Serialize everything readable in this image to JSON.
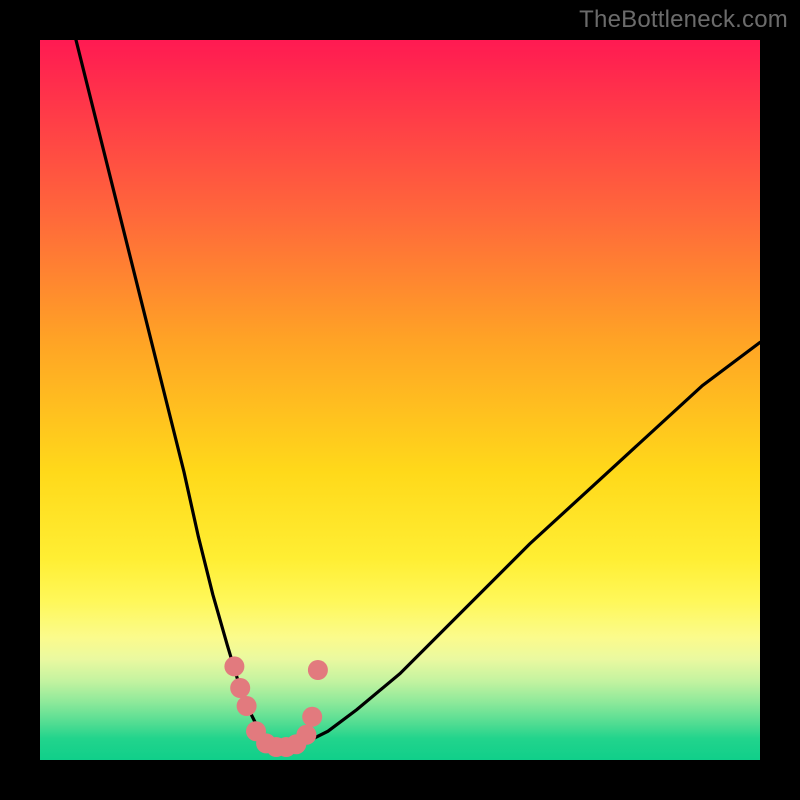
{
  "watermark": "TheBottleneck.com",
  "chart_data": {
    "type": "line",
    "title": "",
    "xlabel": "",
    "ylabel": "",
    "xlim": [
      0,
      100
    ],
    "ylim": [
      0,
      100
    ],
    "grid": false,
    "legend": false,
    "series": [
      {
        "name": "bottleneck-curve",
        "x": [
          5,
          8,
          11,
          14,
          17,
          20,
          22,
          24,
          26,
          27.5,
          29,
          30.5,
          32,
          33.5,
          35,
          37,
          40,
          44,
          50,
          58,
          68,
          80,
          92,
          100
        ],
        "y": [
          100,
          88,
          76,
          64,
          52,
          40,
          31,
          23,
          16,
          11,
          7,
          4,
          2.5,
          2,
          2,
          2.5,
          4,
          7,
          12,
          20,
          30,
          41,
          52,
          58
        ]
      }
    ],
    "markers": {
      "name": "highlight-points",
      "color": "#e27a7e",
      "radius_px": 10,
      "x": [
        27.0,
        27.8,
        28.7,
        30.0,
        31.4,
        32.8,
        34.2,
        35.6,
        37.0,
        37.8,
        38.6
      ],
      "y": [
        13.0,
        10.0,
        7.5,
        4.0,
        2.3,
        1.8,
        1.8,
        2.2,
        3.5,
        6.0,
        12.5
      ]
    },
    "background_gradient": {
      "orientation": "vertical",
      "stops": [
        {
          "pos": 0.0,
          "color": "#ff1a52"
        },
        {
          "pos": 0.25,
          "color": "#ff6a3a"
        },
        {
          "pos": 0.6,
          "color": "#ffd91a"
        },
        {
          "pos": 0.85,
          "color": "#eaf9a0"
        },
        {
          "pos": 1.0,
          "color": "#10cf8a"
        }
      ]
    }
  }
}
